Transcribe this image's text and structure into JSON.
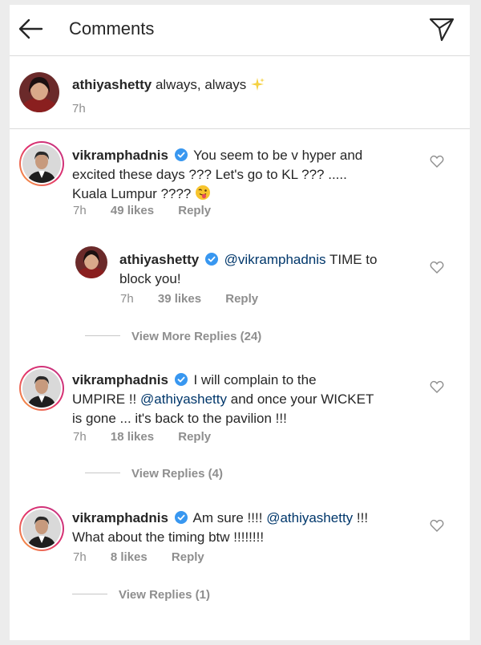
{
  "header": {
    "title": "Comments",
    "back_icon": "arrow-left-icon",
    "send_icon": "paper-plane-icon"
  },
  "caption": {
    "username": "athiyashetty",
    "text": "always, always",
    "emoji": "sparkles-icon",
    "time": "7h"
  },
  "comments": [
    {
      "username": "vikramphadnis",
      "verified": true,
      "text": "You seem to be v hyper and excited these days ??? Let's go to KL ??? ..... Kuala Lumpur ????",
      "text_line1": "You seem to be v hyper and",
      "text_line2": "excited these days ??? Let's go to KL ??? .....",
      "text_line3": "Kuala Lumpur ????",
      "emoji": "winking-tongue-face-icon",
      "time": "7h",
      "likes": "49 likes",
      "reply": "Reply"
    },
    {
      "username": "athiyashetty",
      "verified": true,
      "mention": "@vikramphadnis",
      "text_line1": "TIME to",
      "text_line2": "block you!",
      "time": "7h",
      "likes": "39 likes",
      "reply": "Reply",
      "is_reply": true
    },
    {
      "username": "vikramphadnis",
      "verified": true,
      "text_line1": "I will complain to the",
      "text_line2_pre": "UMPIRE !!",
      "mention": "@athiyashetty",
      "text_line2_post": "and once your WICKET",
      "text_line3": "is gone ... it's back to the pavilion !!!",
      "time": "7h",
      "likes": "18 likes",
      "reply": "Reply"
    },
    {
      "username": "vikramphadnis",
      "verified": true,
      "text_line1_pre": "Am sure !!!!",
      "mention": "@athiyashetty",
      "text_line1_post": "!!!",
      "text_line2": "What about the timing btw !!!!!!!!",
      "time": "7h",
      "likes": "8 likes",
      "reply": "Reply"
    }
  ],
  "view_more_replies_1": "View More Replies (24)",
  "view_replies_2": "View Replies (4)",
  "view_replies_3": "View Replies (1)",
  "colors": {
    "verified": "#3897f0",
    "mention": "#00376b",
    "meta": "#8e8e8e",
    "ring_start": "#f9a93b",
    "ring_end": "#c13584"
  }
}
